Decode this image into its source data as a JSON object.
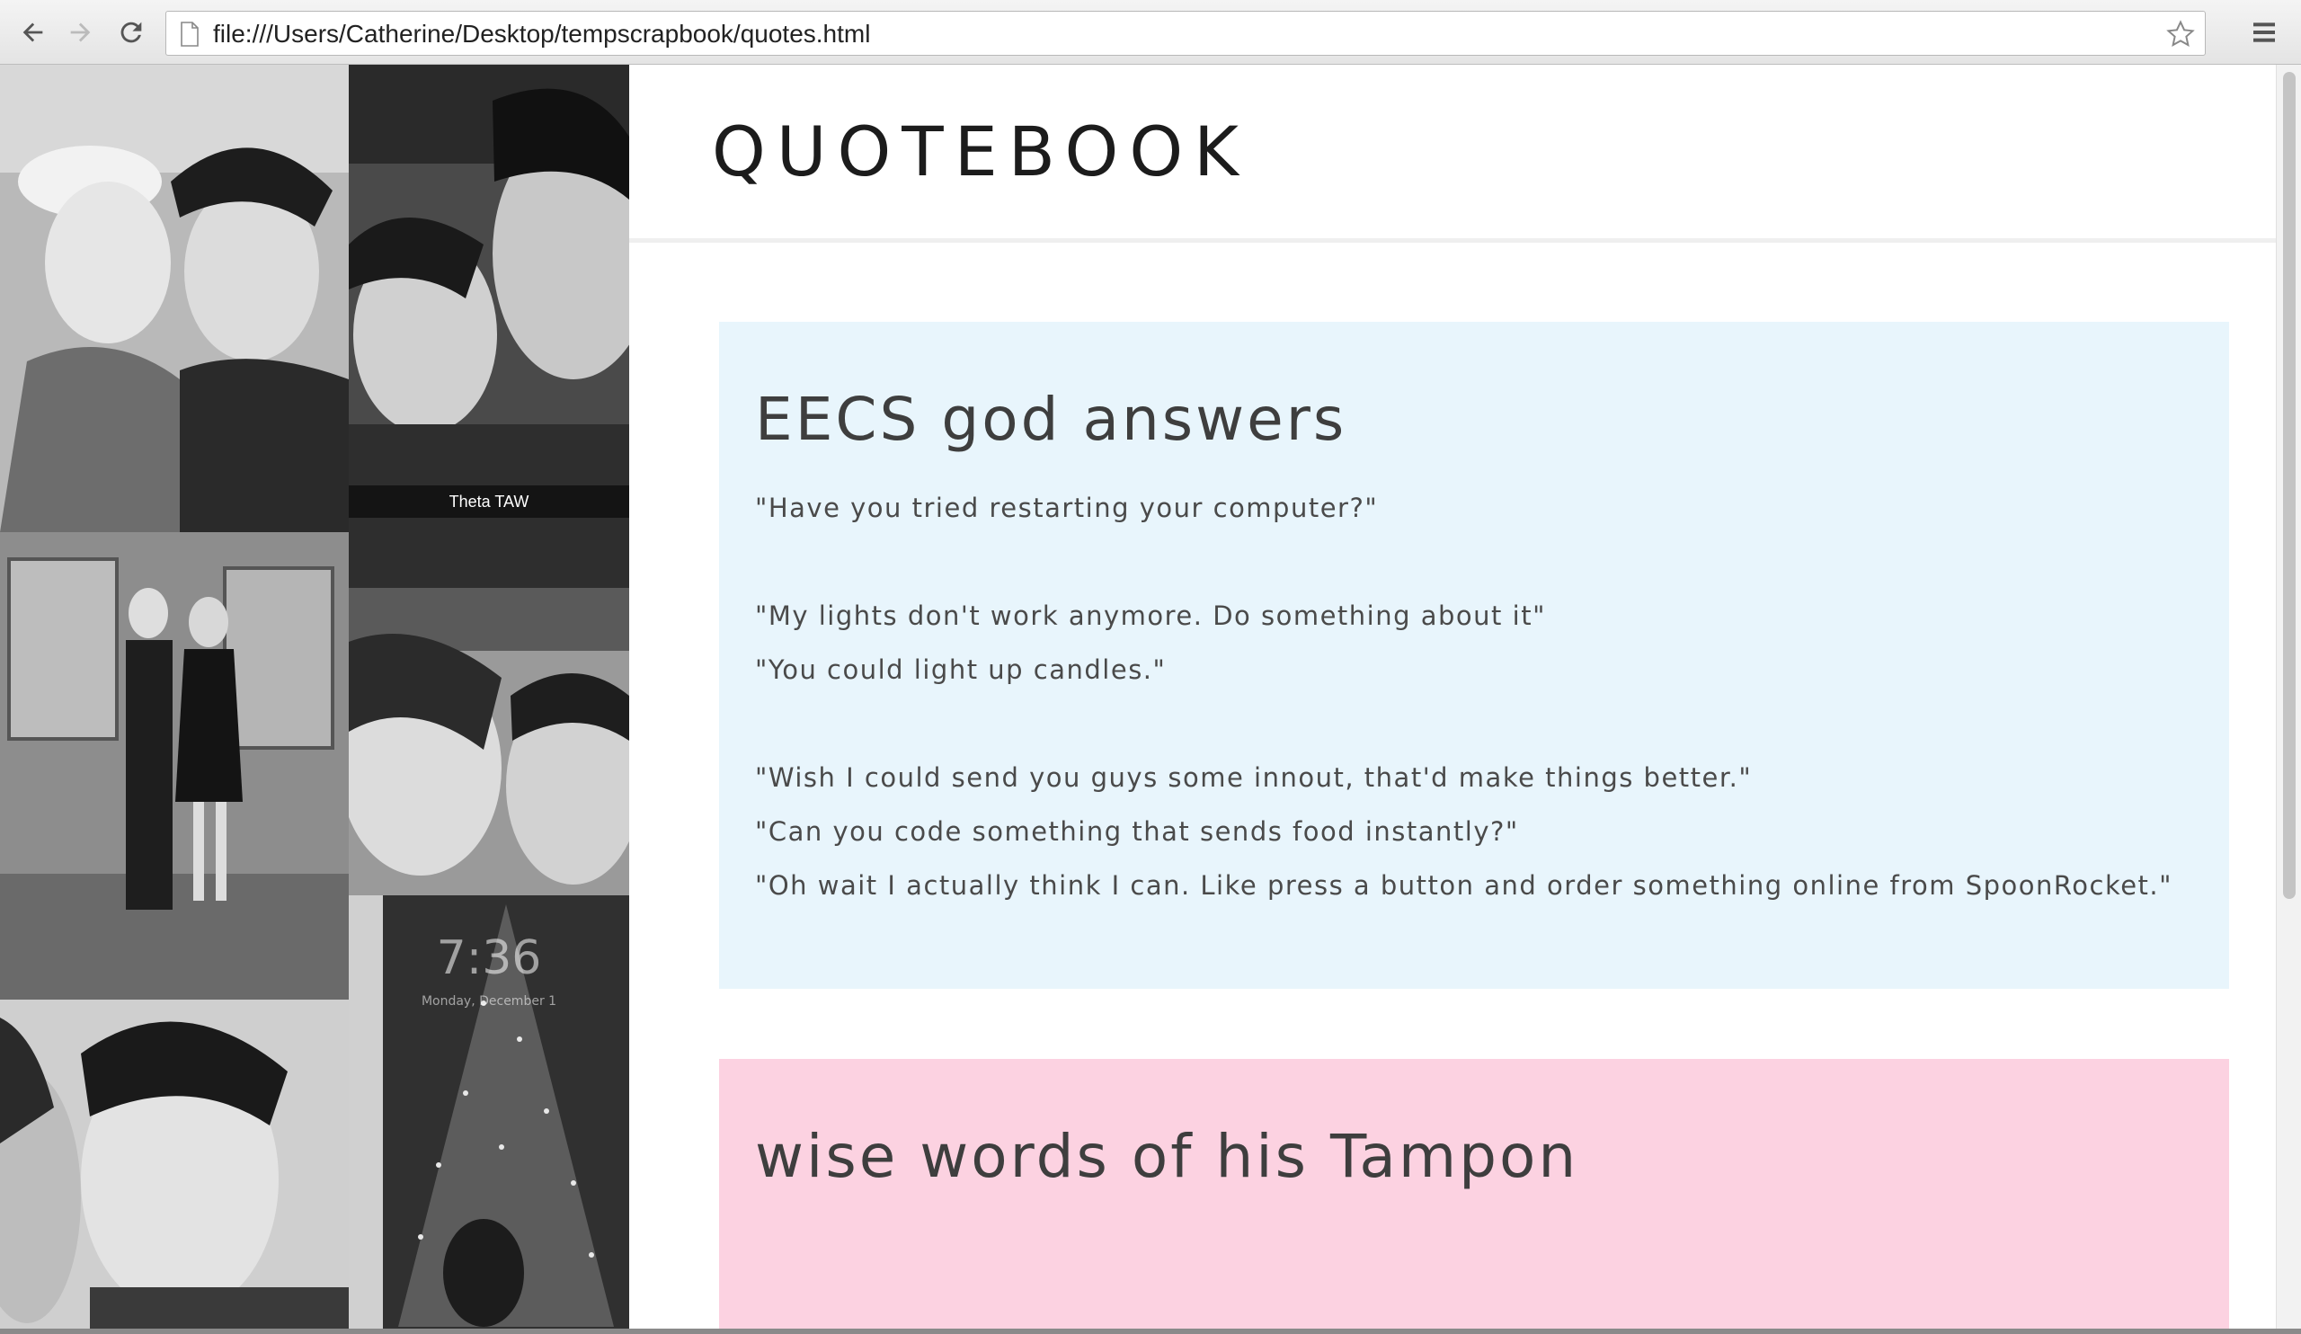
{
  "browser": {
    "url": "file:///Users/Catherine/Desktop/tempscrapbook/quotes.html",
    "back_icon": "arrow-left-icon",
    "forward_icon": "arrow-right-icon",
    "reload_icon": "reload-icon",
    "bookmark_icon": "star-icon",
    "menu_icon": "hamburger-menu-icon"
  },
  "collage": {
    "snap_caption": "Theta TAW",
    "phone_time": "7:36",
    "phone_date": "Monday, December 1"
  },
  "site": {
    "title": "QUOTEBOOK"
  },
  "cards": [
    {
      "title": "EECS god answers",
      "color": "#e8f5fc",
      "quotes": [
        "\"Have you tried restarting your computer?\"",
        "\"My lights don't work anymore. Do something about it\"",
        "\"You could light up candles.\"",
        "\"Wish I could send you guys some innout, that'd make things better.\"",
        "\"Can you code something that sends food instantly?\"",
        "\"Oh wait I actually think I can. Like press a button and order something online from SpoonRocket.\""
      ]
    },
    {
      "title": "wise words of his Tampon",
      "color": "#fcd2e1",
      "quotes": []
    }
  ]
}
